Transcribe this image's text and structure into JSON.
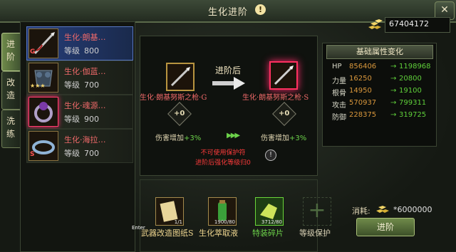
{
  "window": {
    "title": "生化进阶",
    "info": "!",
    "close": "✕"
  },
  "gold": {
    "amount": "67404172"
  },
  "tabs": [
    {
      "label": "进阶",
      "active": true
    },
    {
      "label": "改造",
      "active": false
    },
    {
      "label": "洗练",
      "active": false
    }
  ],
  "items": [
    {
      "name": "生化·朗基…",
      "level_label": "等级",
      "level": "800",
      "badge": "G"
    },
    {
      "name": "生化·伽蓝…",
      "level_label": "等级",
      "level": "700",
      "badge": "★★★"
    },
    {
      "name": "生化·魂源…",
      "level_label": "等级",
      "level": "900",
      "badge": ""
    },
    {
      "name": "生化·海拉…",
      "level_label": "等级",
      "level": "700",
      "badge": "S"
    }
  ],
  "advance": {
    "arrow_label": "进阶后",
    "before_name": "生化·朗基努斯之枪·G",
    "after_name": "生化·朗基努斯之枪·S",
    "before_plus": "+0",
    "after_plus": "+0",
    "before_dmg_label": "伤害增加",
    "before_dmg_value": "+3%",
    "after_dmg_label": "伤害增加",
    "after_dmg_value": "+3%",
    "triple_arrow": "▶▶▶",
    "warning_line1": "不可使用保护符",
    "warning_line2": "进阶后强化等级归0"
  },
  "stats": {
    "header": "基础属性变化",
    "rows": [
      {
        "key": "HP",
        "before": "856406",
        "after": "1198968"
      },
      {
        "key": "力量",
        "before": "16250",
        "after": "20800"
      },
      {
        "key": "根骨",
        "before": "14950",
        "after": "19100"
      },
      {
        "key": "攻击",
        "before": "570937",
        "after": "799311"
      },
      {
        "key": "防御",
        "before": "228375",
        "after": "319725"
      }
    ],
    "arrow": "→"
  },
  "materials": [
    {
      "label": "武器改造图纸S",
      "count": "1/1"
    },
    {
      "label": "生化萃取液",
      "count": "1900/80"
    },
    {
      "label": "特装碎片",
      "count": "3712/80"
    }
  ],
  "protection": {
    "label": "等级保护",
    "plus": "+"
  },
  "cost": {
    "label": "消耗:",
    "value": "*6000000"
  },
  "advance_button": "进阶",
  "overlay": {
    "enter": "Enter"
  },
  "colors": {
    "name_red": "#f06a6a",
    "stat_green": "#5fcf3a",
    "stat_orange": "#d9973c",
    "selected_blue": "#273e7a"
  }
}
